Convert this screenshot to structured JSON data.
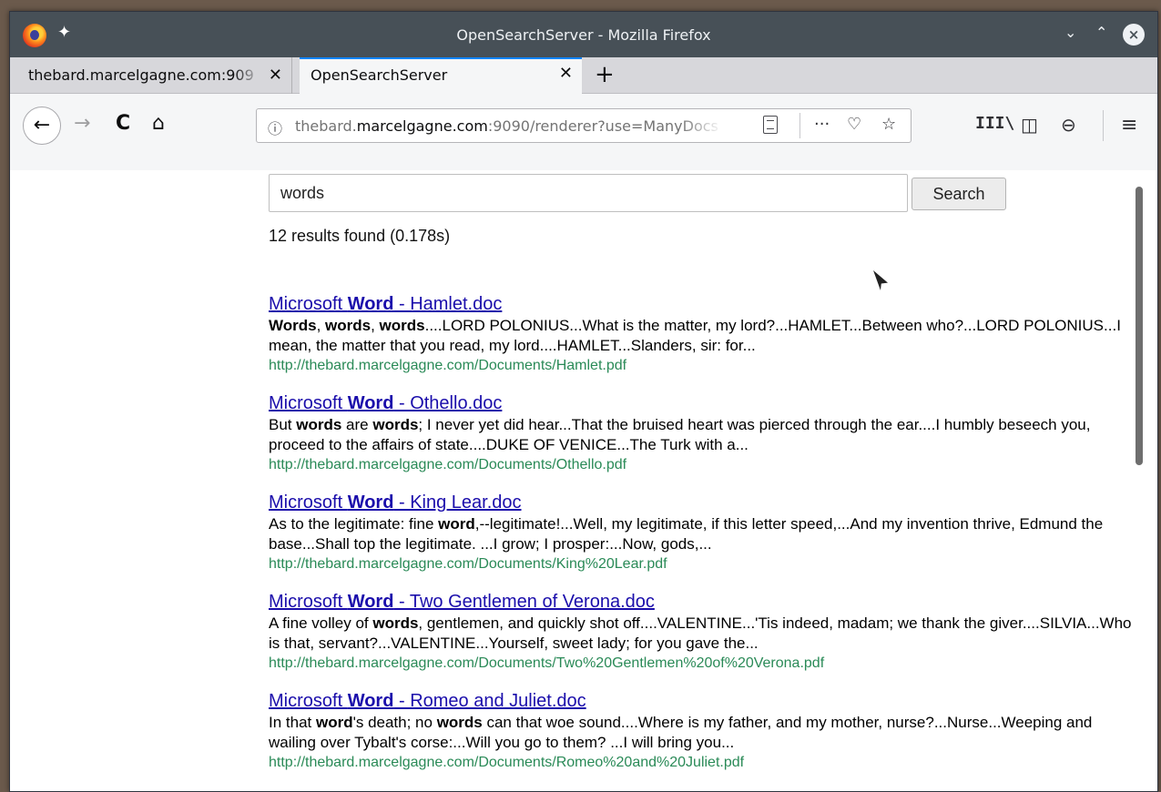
{
  "window": {
    "title": "OpenSearchServer - Mozilla Firefox",
    "controls": {
      "minimize": "⌄",
      "maximize": "⌃",
      "close": "×"
    }
  },
  "tabs": [
    {
      "label": "thebard.marcelgagne.com:909",
      "close": "✕",
      "active": false
    },
    {
      "label": "OpenSearchServer",
      "close": "✕",
      "active": true
    }
  ],
  "new_tab": "+",
  "nav": {
    "back": "←",
    "forward": "→",
    "reload": "C",
    "home": "⌂",
    "info": "ⓘ",
    "url_host_pre": "thebard.",
    "url_host": "marcelgagne.com",
    "url_rest": ":9090/renderer?use=ManyDocs",
    "more": "···",
    "pocket": "♡",
    "star": "☆",
    "library": "III\\",
    "sidebar": "◫",
    "account": "⊖",
    "menu": "≡"
  },
  "search": {
    "query": "words",
    "button_label": "Search",
    "result_count": "12 results found (0.178s)"
  },
  "results": [
    {
      "title_pre": "Microsoft ",
      "title_bold": "Word",
      "title_post": " - Hamlet.doc",
      "snippet": [
        {
          "t": "Words",
          "b": true
        },
        {
          "t": ", ",
          "b": false
        },
        {
          "t": "words",
          "b": true
        },
        {
          "t": ", ",
          "b": false
        },
        {
          "t": "words",
          "b": true
        },
        {
          "t": "....LORD POLONIUS...What is the matter, my lord?...HAMLET...Between who?...LORD POLONIUS...I mean, the matter that you read, my lord....HAMLET...Slanders, sir: for...",
          "b": false
        }
      ],
      "url": "http://thebard.marcelgagne.com/Documents/Hamlet.pdf"
    },
    {
      "title_pre": "Microsoft ",
      "title_bold": "Word",
      "title_post": " - Othello.doc",
      "snippet": [
        {
          "t": "But ",
          "b": false
        },
        {
          "t": "words",
          "b": true
        },
        {
          "t": " are ",
          "b": false
        },
        {
          "t": "words",
          "b": true
        },
        {
          "t": "; I never yet did hear...That the bruised heart was pierced through the ear....I humbly beseech you, proceed to the affairs of state....DUKE OF VENICE...The Turk with a...",
          "b": false
        }
      ],
      "url": "http://thebard.marcelgagne.com/Documents/Othello.pdf"
    },
    {
      "title_pre": "Microsoft ",
      "title_bold": "Word",
      "title_post": " - King Lear.doc",
      "snippet": [
        {
          "t": "As to the legitimate: fine ",
          "b": false
        },
        {
          "t": "word",
          "b": true
        },
        {
          "t": ",--legitimate!...Well, my legitimate, if this letter speed,...And my invention thrive, Edmund the base...Shall top the legitimate. ...I grow; I prosper:...Now, gods,...",
          "b": false
        }
      ],
      "url": "http://thebard.marcelgagne.com/Documents/King%20Lear.pdf"
    },
    {
      "title_pre": "Microsoft ",
      "title_bold": "Word",
      "title_post": " - Two Gentlemen of Verona.doc",
      "snippet": [
        {
          "t": "A fine volley of ",
          "b": false
        },
        {
          "t": "words",
          "b": true
        },
        {
          "t": ", gentlemen, and quickly shot off....VALENTINE...'Tis indeed, madam; we thank the giver....SILVIA...Who is that, servant?...VALENTINE...Yourself, sweet lady; for you gave the...",
          "b": false
        }
      ],
      "url": "http://thebard.marcelgagne.com/Documents/Two%20Gentlemen%20of%20Verona.pdf"
    },
    {
      "title_pre": "Microsoft ",
      "title_bold": "Word",
      "title_post": " - Romeo and Juliet.doc",
      "snippet": [
        {
          "t": "In that ",
          "b": false
        },
        {
          "t": "word",
          "b": true
        },
        {
          "t": "'s death; no ",
          "b": false
        },
        {
          "t": "words",
          "b": true
        },
        {
          "t": " can that woe sound....Where is my father, and my mother, nurse?...Nurse...Weeping and wailing over Tybalt's corse:...Will you go to them? ...I will bring you...",
          "b": false
        }
      ],
      "url": "http://thebard.marcelgagne.com/Documents/Romeo%20and%20Juliet.pdf"
    }
  ]
}
